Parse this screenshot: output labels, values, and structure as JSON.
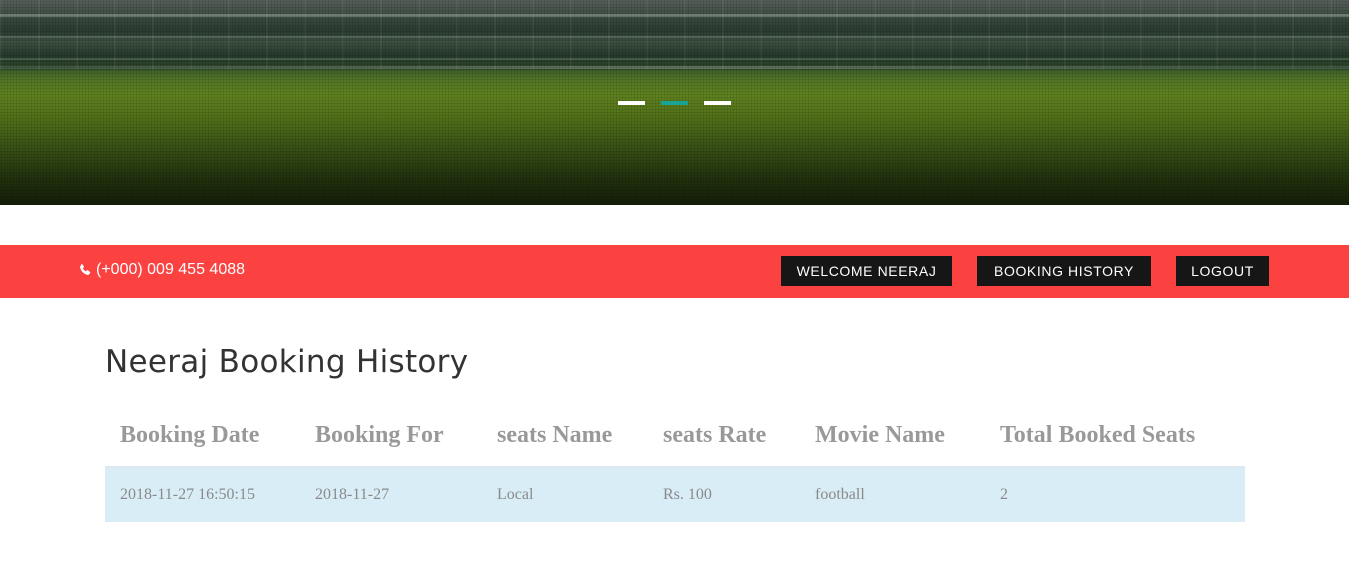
{
  "hero": {
    "slides": [
      {
        "active": false
      },
      {
        "active": true
      },
      {
        "active": false
      }
    ],
    "active_color": "#1aa394"
  },
  "topbar": {
    "background": "#fc4141",
    "phone_icon": "phone-icon",
    "phone": "(+000) 009 455 4088",
    "welcome_label": "WELCOME NEERAJ",
    "history_label": "BOOKING HISTORY",
    "logout_label": "LOGOUT"
  },
  "main": {
    "title": "Neeraj Booking History",
    "table": {
      "headers": [
        "Booking Date",
        "Booking For",
        "seats Name",
        "seats Rate",
        "Movie Name",
        "Total Booked Seats"
      ],
      "rows": [
        [
          "2018-11-27 16:50:15",
          "2018-11-27",
          "Local",
          "Rs. 100",
          "football",
          "2"
        ]
      ],
      "row_background": "#d9edf7"
    }
  }
}
